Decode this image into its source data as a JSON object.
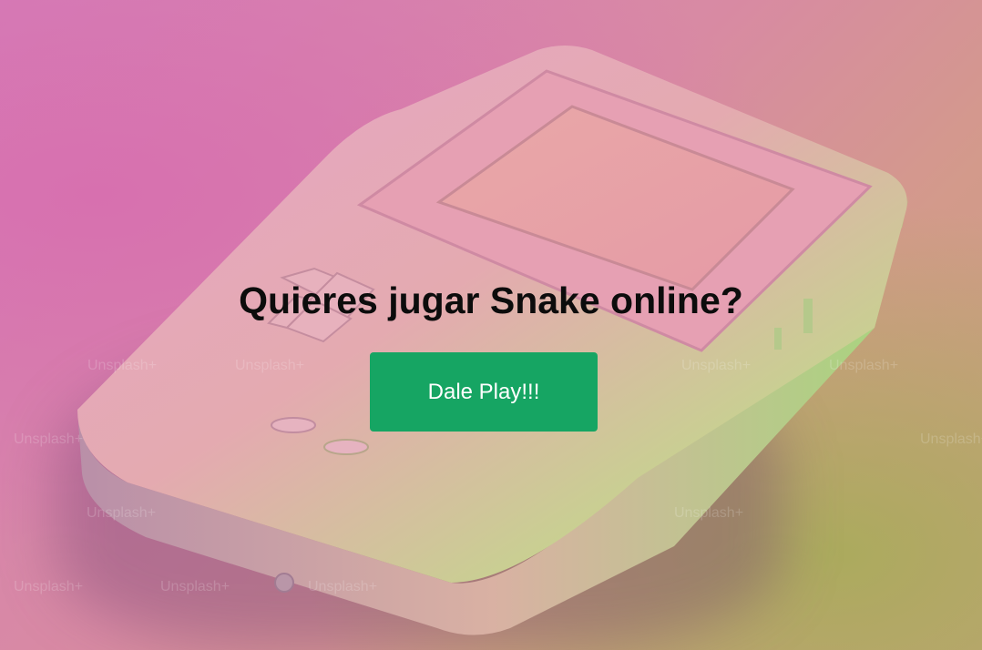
{
  "hero": {
    "heading": "Quieres jugar Snake online?",
    "play_button_label": "Dale Play!!!",
    "button_color": "#16a563"
  },
  "background": {
    "subject": "pastel handheld game console photo",
    "watermark_text": "Unsplash+"
  }
}
